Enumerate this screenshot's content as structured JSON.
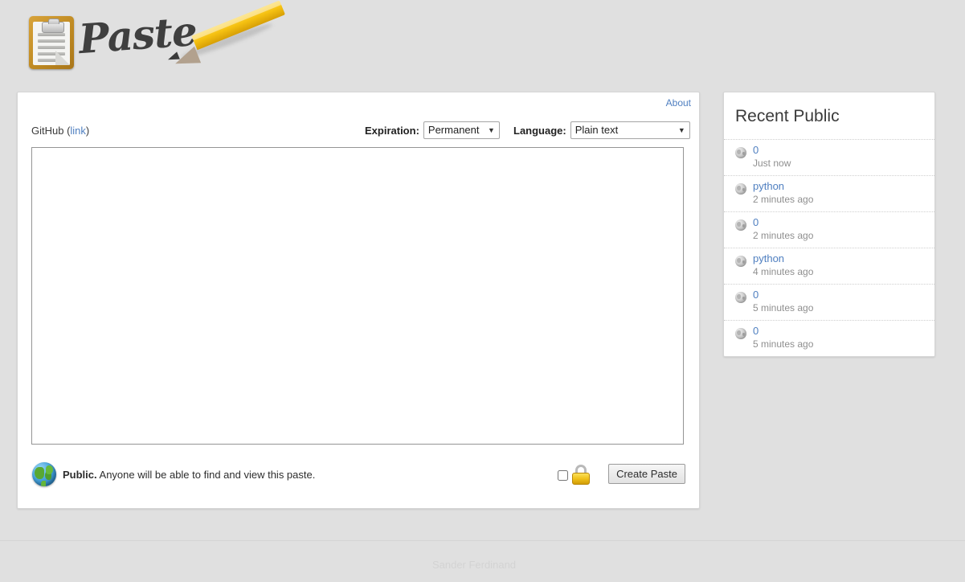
{
  "site": {
    "logo_text": "Paste",
    "logo_icons": [
      "clipboard-icon",
      "pencil-icon"
    ]
  },
  "card": {
    "about_label": "About",
    "github_prefix": "GitHub (",
    "github_link_label": "link",
    "github_suffix": ")",
    "expiration": {
      "label": "Expiration:",
      "value": "Permanent",
      "options": [
        "Permanent"
      ]
    },
    "language": {
      "label": "Language:",
      "value": "Plain text",
      "options": [
        "Plain text"
      ]
    },
    "textarea": {
      "value": "",
      "placeholder": ""
    },
    "visibility": {
      "bold": "Public.",
      "text": " Anyone will be able to find and view this paste."
    },
    "create_button_label": "Create Paste"
  },
  "recent": {
    "title": "Recent Public",
    "items": [
      {
        "name": "0",
        "time": "Just now"
      },
      {
        "name": "python",
        "time": "2 minutes ago"
      },
      {
        "name": "0",
        "time": "2 minutes ago"
      },
      {
        "name": "python",
        "time": "4 minutes ago"
      },
      {
        "name": "0",
        "time": "5 minutes ago"
      },
      {
        "name": "0",
        "time": "5 minutes ago"
      }
    ]
  },
  "footer": {
    "credit": "Sander Ferdinand"
  },
  "colors": {
    "page_background": "#e0e0e0",
    "card_background": "#ffffff",
    "link": "#4f7fc0",
    "muted_text": "#8f8f8f",
    "footer_text": "#d3d3d3",
    "pencil_yellow": "#f5c111",
    "clipboard_border": "#bf8a22",
    "padlock_gold": "#f0c21b"
  }
}
